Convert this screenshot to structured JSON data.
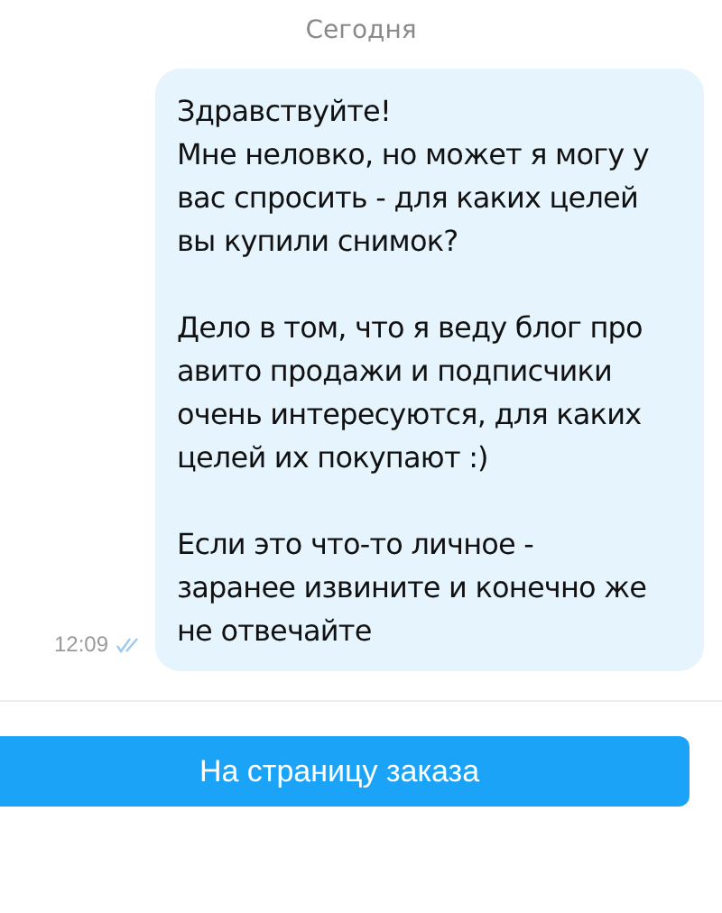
{
  "date_separator": "Сегодня",
  "message": {
    "time": "12:09",
    "read": true,
    "paragraphs": [
      [
        "Здравствуйте!",
        "Мне неловко, но может я могу у",
        "вас спросить - для каких целей",
        "вы купили снимок?"
      ],
      [
        "Дело в том, что я веду блог про",
        "авито продажи и подписчики",
        "очень интересуются, для каких",
        "целей их покупают :)"
      ],
      [
        "Если это что-то личное -",
        "заранее извините и конечно же",
        "не отвечайте"
      ]
    ]
  },
  "button": {
    "label": "На страницу заказа"
  }
}
